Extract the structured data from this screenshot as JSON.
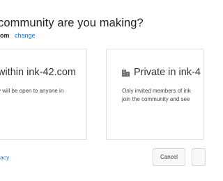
{
  "dialog": {
    "title": "community are you making?",
    "domain_text": "om",
    "change_label": "change",
    "options": [
      {
        "title": "within ink-42.com",
        "description": "y will be open to anyone in"
      },
      {
        "icon": "building-icon",
        "title": "Private in ink-4",
        "description_lines": [
          "Only invited members of ink",
          "join the community and see"
        ]
      }
    ],
    "privacy_label": "acy",
    "cancel_label": "Cancel"
  }
}
